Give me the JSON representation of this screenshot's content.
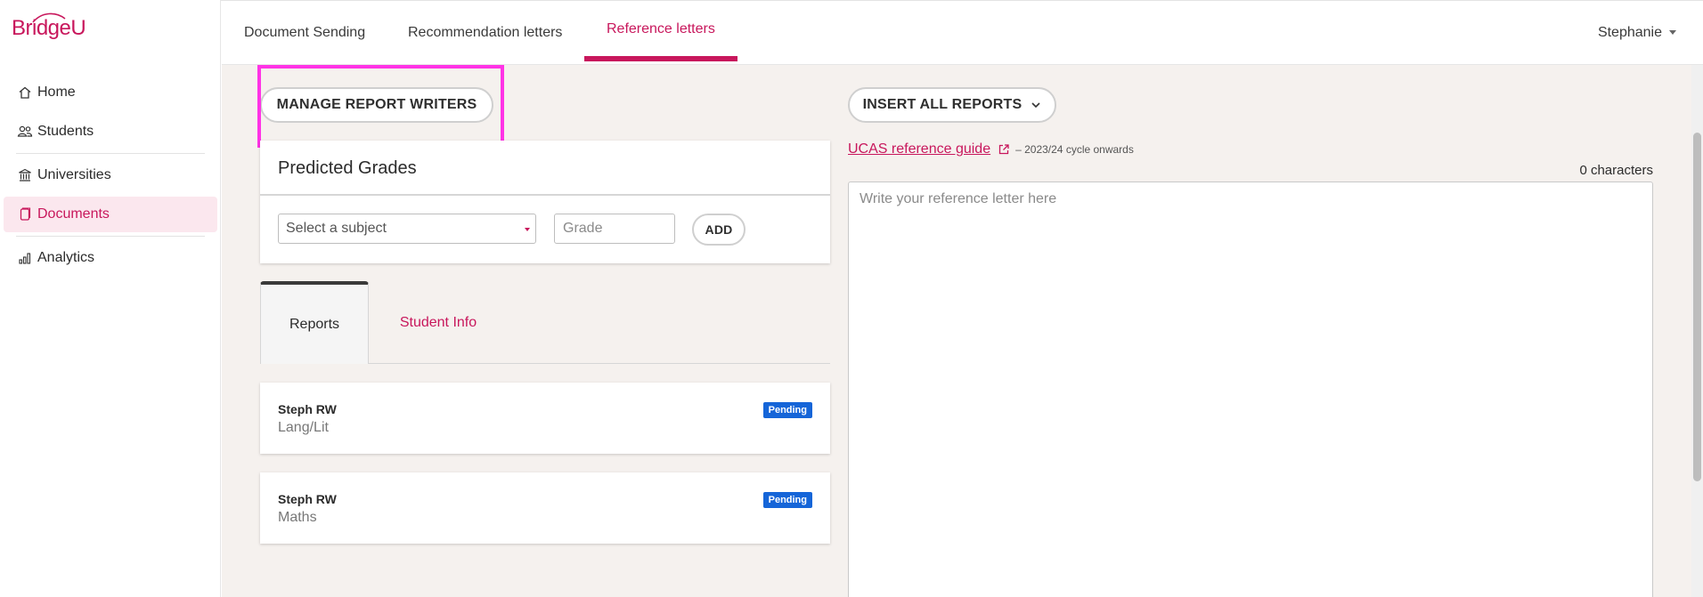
{
  "brand": {
    "logo_text": "BridgeU",
    "accent": "#c8175c"
  },
  "sidebar": {
    "items": [
      {
        "label": "Home",
        "icon": "home-icon"
      },
      {
        "label": "Students",
        "icon": "students-icon"
      },
      {
        "label": "Universities",
        "icon": "university-icon"
      },
      {
        "label": "Documents",
        "icon": "document-icon",
        "active": true
      },
      {
        "label": "Analytics",
        "icon": "analytics-icon"
      }
    ]
  },
  "topnav": {
    "tabs": [
      {
        "label": "Document Sending"
      },
      {
        "label": "Recommendation letters"
      },
      {
        "label": "Reference letters",
        "active": true
      }
    ],
    "user": "Stephanie"
  },
  "actions": {
    "manage_report_writers": "MANAGE REPORT WRITERS",
    "insert_all_reports": "INSERT ALL REPORTS"
  },
  "predicted_grades": {
    "title": "Predicted Grades",
    "subject_placeholder": "Select a subject",
    "grade_placeholder": "Grade",
    "add_label": "ADD"
  },
  "subtabs": [
    {
      "label": "Reports",
      "active": true
    },
    {
      "label": "Student Info"
    }
  ],
  "reports": [
    {
      "name": "Steph RW",
      "subject": "Lang/Lit",
      "status": "Pending"
    },
    {
      "name": "Steph RW",
      "subject": "Maths",
      "status": "Pending"
    }
  ],
  "reference": {
    "guide_link": "UCAS reference guide",
    "guide_note": "– 2023/24 cycle onwards",
    "char_count": "0 characters",
    "placeholder": "Write your reference letter here"
  },
  "colors": {
    "badge": "#1565d8",
    "highlight": "#ff33e6",
    "background": "#f5f1ee"
  }
}
